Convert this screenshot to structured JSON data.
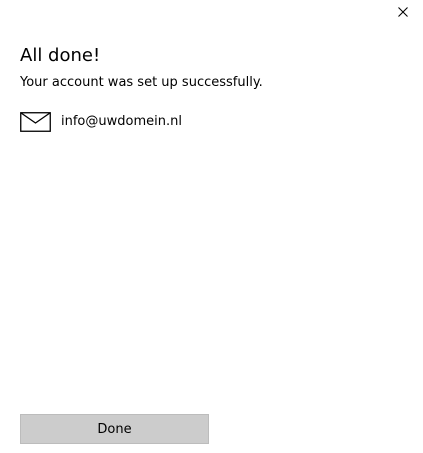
{
  "dialog": {
    "title": "All done!",
    "subtitle": "Your account was set up successfully.",
    "close_icon": "close-icon"
  },
  "account": {
    "icon": "mail-icon",
    "email": "info@uwdomein.nl"
  },
  "footer": {
    "done_label": "Done"
  },
  "colors": {
    "background": "#ffffff",
    "text": "#000000",
    "button_bg": "#cccccc"
  }
}
